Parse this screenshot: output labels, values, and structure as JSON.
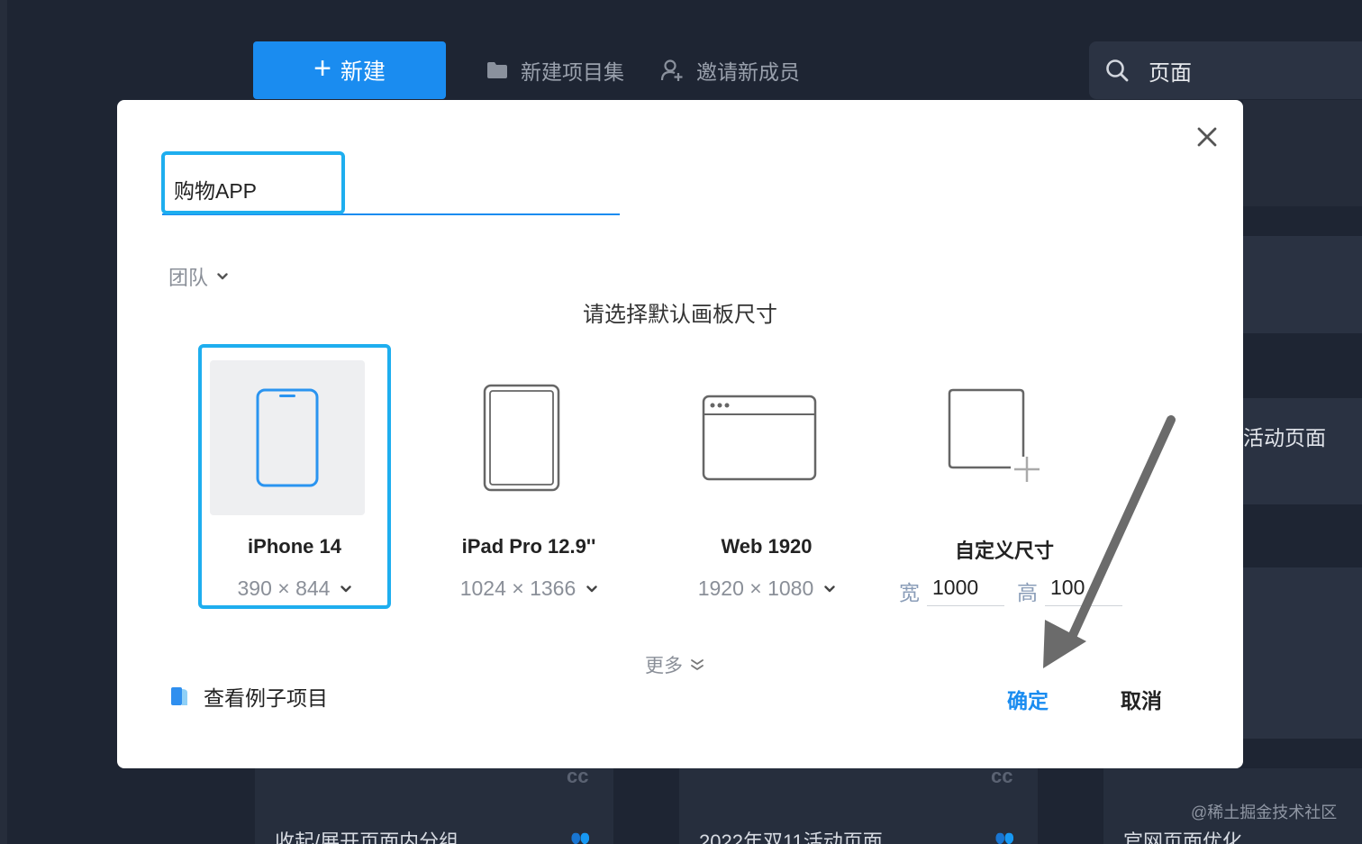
{
  "toolbar": {
    "new_label": "新建",
    "new_collection_label": "新建项目集",
    "invite_label": "邀请新成员",
    "search_text": "页面"
  },
  "background": {
    "cards": [
      {
        "title": "收起/展开页面内分组",
        "badge": "cc"
      },
      {
        "title": "2022年双11活动页面",
        "badge": "cc"
      },
      {
        "title": "官网页面优化"
      }
    ],
    "right_text": "活动页面",
    "watermark": "@稀土掘金技术社区"
  },
  "modal": {
    "project_name": "购物APP",
    "team_label": "团队",
    "section_title": "请选择默认画板尺寸",
    "options": [
      {
        "name": "iPhone 14",
        "size": "390 × 844",
        "selected": true,
        "icon": "phone-icon"
      },
      {
        "name": "iPad Pro 12.9''",
        "size": "1024 × 1366",
        "selected": false,
        "icon": "tablet-icon"
      },
      {
        "name": "Web 1920",
        "size": "1920 × 1080",
        "selected": false,
        "icon": "browser-window-icon"
      },
      {
        "name": "自定义尺寸",
        "selected": false,
        "icon": "custom-size-icon"
      }
    ],
    "custom": {
      "width_label": "宽",
      "width_value": "1000",
      "height_label": "高",
      "height_value": "100"
    },
    "more_label": "更多",
    "example_label": "查看例子项目",
    "confirm_label": "确定",
    "cancel_label": "取消"
  },
  "colors": {
    "accent": "#1a8cf0",
    "selection_border": "#1eaeef",
    "background": "#1e2533"
  }
}
